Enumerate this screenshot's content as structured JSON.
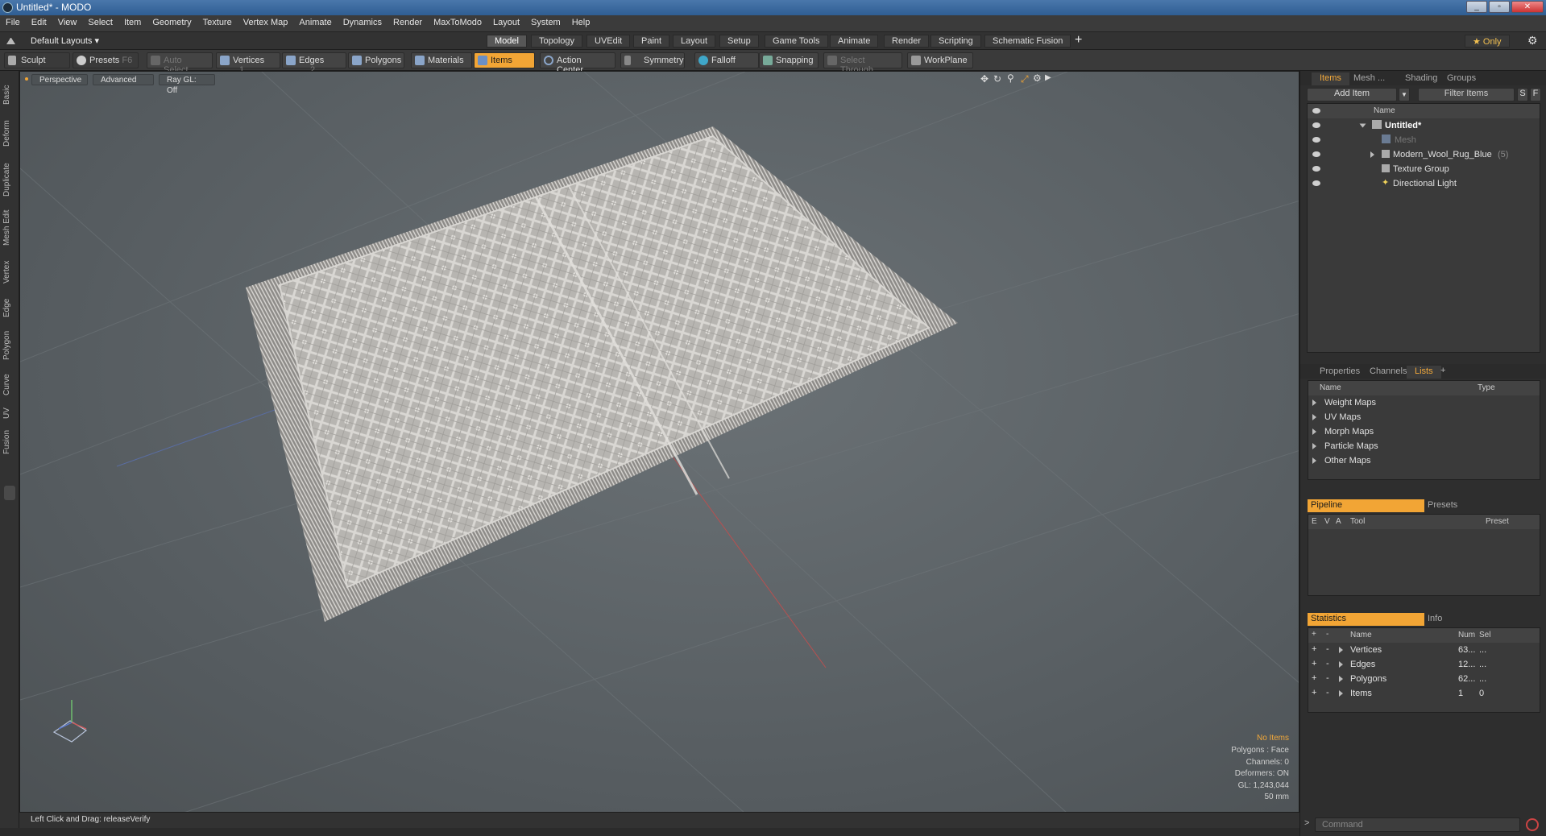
{
  "window": {
    "title": "Untitled* - MODO",
    "buttons": [
      "_",
      "▫",
      "✕"
    ]
  },
  "menu": [
    "File",
    "Edit",
    "View",
    "Select",
    "Item",
    "Geometry",
    "Texture",
    "Vertex Map",
    "Animate",
    "Dynamics",
    "Render",
    "MaxToModo",
    "Layout",
    "System",
    "Help"
  ],
  "layout_selector": "Default Layouts ▾",
  "layout_tabs": [
    "Model",
    "Topology",
    "UVEdit",
    "Paint",
    "Layout",
    "Setup",
    "Game Tools",
    "Animate",
    "Render",
    "Scripting",
    "Schematic Fusion"
  ],
  "layout_tab_active": "Model",
  "only_button": "★ Only",
  "toolbar": {
    "sculpt": "Sculpt",
    "presets": "Presets",
    "presets_key": "F6",
    "auto_select": "Auto Select",
    "vertices": "Vertices",
    "vertices_key": "1",
    "edges": "Edges",
    "edges_key": "2",
    "polygons": "Polygons",
    "materials": "Materials",
    "items": "Items",
    "action_center": "Action Center",
    "symmetry": "Symmetry",
    "falloff": "Falloff",
    "snapping": "Snapping",
    "select_through": "Select Through",
    "workplane": "WorkPlane"
  },
  "left_tabs": [
    "Basic",
    "Deform",
    "Duplicate",
    "Mesh Edit",
    "Vertex",
    "Edge",
    "Polygon",
    "Curve",
    "UV",
    "Fusion"
  ],
  "viewport": {
    "view": "Perspective",
    "mode": "Advanced",
    "raygl": "Ray GL: Off"
  },
  "stats": {
    "no_items": "No Items",
    "polygons": "Polygons : Face",
    "channels": "Channels: 0",
    "deformers": "Deformers: ON",
    "gl": "GL: 1,243,044",
    "scale": "50 mm"
  },
  "statusbar": {
    "hint": "Left Click and Drag:  releaseVerify"
  },
  "items_panel": {
    "tabs": [
      "Items",
      "Mesh ...",
      "Shading",
      "Groups"
    ],
    "add_item": "Add Item",
    "filter": "Filter Items",
    "s": "S",
    "f": "F",
    "col_name": "Name",
    "rows": [
      {
        "label": "Untitled*",
        "indent": 0
      },
      {
        "label": "Mesh",
        "indent": 1
      },
      {
        "label": "Modern_Wool_Rug_Blue",
        "suffix": "(5)",
        "indent": 1
      },
      {
        "label": "Texture Group",
        "indent": 1
      },
      {
        "label": "Directional Light",
        "indent": 1
      }
    ]
  },
  "lists_panel": {
    "tabs": [
      "Properties",
      "Channels",
      "Lists"
    ],
    "col_name": "Name",
    "col_type": "Type",
    "rows": [
      "Weight Maps",
      "UV Maps",
      "Morph Maps",
      "Particle Maps",
      "Other Maps"
    ]
  },
  "pipeline": {
    "tab": "Pipeline",
    "tab2": "Presets",
    "cols": [
      "E",
      "V",
      "A",
      "Tool",
      "Preset"
    ]
  },
  "statistics": {
    "tab": "Statistics",
    "tab2": "Info",
    "col_name": "Name",
    "col_num": "Num",
    "col_sel": "Sel",
    "rows": [
      {
        "name": "Vertices",
        "num": "63...",
        "sel": "..."
      },
      {
        "name": "Edges",
        "num": "12...",
        "sel": "..."
      },
      {
        "name": "Polygons",
        "num": "62...",
        "sel": "..."
      },
      {
        "name": "Items",
        "num": "1",
        "sel": "0"
      }
    ]
  },
  "command": {
    "placeholder": "Command"
  },
  "colors": {
    "accent": "#f2a535",
    "viewport_bg": "#5e6468"
  }
}
